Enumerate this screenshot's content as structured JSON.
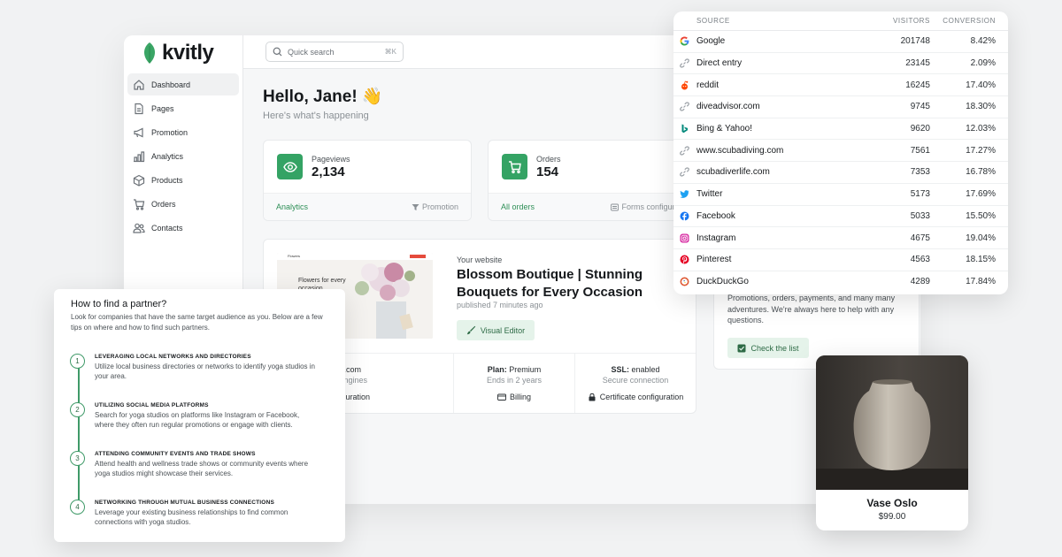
{
  "brand": {
    "name": "kvitly"
  },
  "nav": {
    "items": [
      {
        "label": "Dashboard",
        "icon": "home-icon",
        "active": true
      },
      {
        "label": "Pages",
        "icon": "page-icon"
      },
      {
        "label": "Promotion",
        "icon": "megaphone-icon"
      },
      {
        "label": "Analytics",
        "icon": "bar-chart-icon"
      },
      {
        "label": "Products",
        "icon": "box-icon"
      },
      {
        "label": "Orders",
        "icon": "cart-icon"
      },
      {
        "label": "Contacts",
        "icon": "users-icon"
      }
    ]
  },
  "search": {
    "placeholder": "Quick search",
    "shortcut": "⌘K"
  },
  "dashboard": {
    "greeting": "Hello, Jane! 👋",
    "subtitle": "Here's what's happening",
    "stats": [
      {
        "label": "Pageviews",
        "value": "2,134",
        "link": "Analytics",
        "meta": "Promotion",
        "icon": "eye-icon"
      },
      {
        "label": "Orders",
        "value": "154",
        "link": "All orders",
        "meta": "Forms configurati",
        "icon": "cart-icon"
      }
    ],
    "website": {
      "label": "Your website",
      "title": "Blossom Boutique | Stunning Bouquets for Every Occasion",
      "published": "published 7 minutes ago",
      "editor_button": "Visual Editor",
      "thumb_caption": "Flowers for every occasion",
      "thumb_brand": "Flowers",
      "columns": [
        {
          "key": "",
          "value": "ers.com",
          "sub": "h engines",
          "action": "nfiguration",
          "icon": ""
        },
        {
          "key": "Plan:",
          "value": "Premium",
          "sub": "Ends in 2 years",
          "action": "Billing",
          "icon": "card-icon"
        },
        {
          "key": "SSL:",
          "value": "enabled",
          "sub": "Secure connection",
          "action": "Certificate configuration",
          "icon": "lock-icon"
        }
      ]
    },
    "help": {
      "text": "Promotions, orders, payments, and many many adventures. We're always here to help with any questions.",
      "button": "Check the list"
    }
  },
  "sources": {
    "headers": {
      "source": "SOURCE",
      "visitors": "VISITORS",
      "conversion": "CONVERSION"
    },
    "rows": [
      {
        "name": "Google",
        "visitors": "201748",
        "conversion": "8.42%",
        "icon": "google-icon"
      },
      {
        "name": "Direct entry",
        "visitors": "23145",
        "conversion": "2.09%",
        "icon": "link-icon"
      },
      {
        "name": "reddit",
        "visitors": "16245",
        "conversion": "17.40%",
        "icon": "reddit-icon"
      },
      {
        "name": "diveadvisor.com",
        "visitors": "9745",
        "conversion": "18.30%",
        "icon": "link-icon"
      },
      {
        "name": "Bing & Yahoo!",
        "visitors": "9620",
        "conversion": "12.03%",
        "icon": "bing-icon"
      },
      {
        "name": "www.scubadiving.com",
        "visitors": "7561",
        "conversion": "17.27%",
        "icon": "link-icon"
      },
      {
        "name": "scubadiverlife.com",
        "visitors": "7353",
        "conversion": "16.78%",
        "icon": "link-icon"
      },
      {
        "name": "Twitter",
        "visitors": "5173",
        "conversion": "17.69%",
        "icon": "twitter-icon"
      },
      {
        "name": "Facebook",
        "visitors": "5033",
        "conversion": "15.50%",
        "icon": "facebook-icon"
      },
      {
        "name": "Instagram",
        "visitors": "4675",
        "conversion": "19.04%",
        "icon": "instagram-icon"
      },
      {
        "name": "Pinterest",
        "visitors": "4563",
        "conversion": "18.15%",
        "icon": "pinterest-icon"
      },
      {
        "name": "DuckDuckGo",
        "visitors": "4289",
        "conversion": "17.84%",
        "icon": "duckduckgo-icon"
      }
    ]
  },
  "partner": {
    "title": "How to find a partner?",
    "intro": "Look for companies that have the same target audience as you. Below are a few tips on where and how to find such partners.",
    "steps": [
      {
        "num": "1",
        "title": "LEVERAGING LOCAL NETWORKS AND DIRECTORIES",
        "desc": "Utilize local business directories or networks to identify yoga studios in your area."
      },
      {
        "num": "2",
        "title": "UTILIZING SOCIAL MEDIA PLATFORMS",
        "desc": "Search for yoga studios on platforms like Instagram or Facebook, where they often run regular promotions or engage with clients."
      },
      {
        "num": "3",
        "title": "ATTENDING COMMUNITY EVENTS AND TRADE SHOWS",
        "desc": "Attend health and wellness trade shows or community events where yoga studios might showcase their services."
      },
      {
        "num": "4",
        "title": "NETWORKING THROUGH MUTUAL BUSINESS CONNECTIONS",
        "desc": "Leverage your existing business relationships to find common connections with yoga studios."
      }
    ]
  },
  "product": {
    "name": "Vase Oslo",
    "price": "$99.00"
  },
  "colors": {
    "accent": "#34a364",
    "accent_soft": "#e5f3ea",
    "accent_text": "#2e6b46"
  }
}
